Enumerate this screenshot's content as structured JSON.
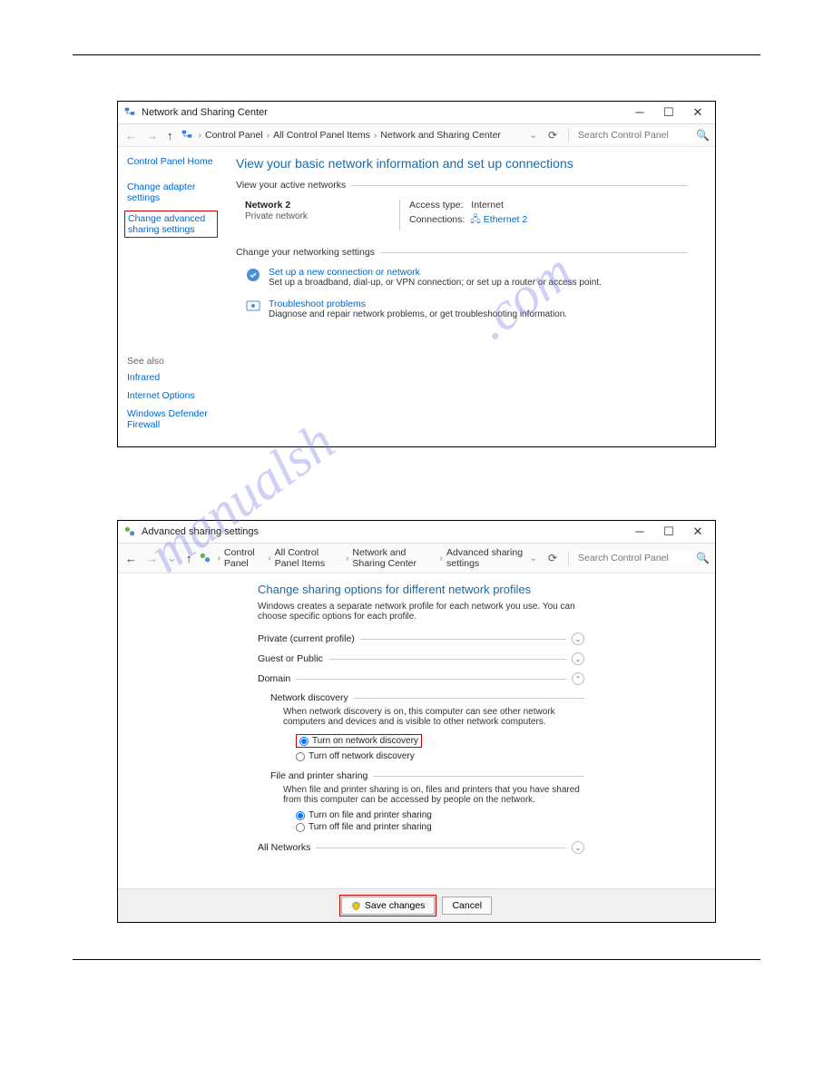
{
  "watermark": "manualshive.com",
  "win1": {
    "title": "Network and Sharing Center",
    "breadcrumb": [
      "Control Panel",
      "All Control Panel Items",
      "Network and Sharing Center"
    ],
    "search_placeholder": "Search Control Panel",
    "sidebar": {
      "home": "Control Panel Home",
      "adapter": "Change adapter settings",
      "advanced": "Change advanced sharing settings"
    },
    "seealso": {
      "heading": "See also",
      "items": [
        "Infrared",
        "Internet Options",
        "Windows Defender Firewall"
      ]
    },
    "main_title": "View your basic network information and set up connections",
    "active_label": "View your active networks",
    "network": {
      "name": "Network 2",
      "type": "Private network",
      "access_label": "Access type:",
      "access_value": "Internet",
      "conn_label": "Connections:",
      "conn_value": "Ethernet 2"
    },
    "change_label": "Change your networking settings",
    "setup": {
      "title": "Set up a new connection or network",
      "desc": "Set up a broadband, dial-up, or VPN connection; or set up a router or access point."
    },
    "trouble": {
      "title": "Troubleshoot problems",
      "desc": "Diagnose and repair network problems, or get troubleshooting information."
    }
  },
  "win2": {
    "title": "Advanced sharing settings",
    "breadcrumb": [
      "Control Panel",
      "All Control Panel Items",
      "Network and Sharing Center",
      "Advanced sharing settings"
    ],
    "search_placeholder": "Search Control Panel",
    "main_title": "Change sharing options for different network profiles",
    "desc": "Windows creates a separate network profile for each network you use. You can choose specific options for each profile.",
    "profiles": {
      "private": "Private (current profile)",
      "guest": "Guest or Public",
      "domain": "Domain",
      "all": "All Networks"
    },
    "discovery": {
      "title": "Network discovery",
      "desc": "When network discovery is on, this computer can see other network computers and devices and is visible to other network computers.",
      "on": "Turn on network discovery",
      "off": "Turn off network discovery"
    },
    "fileshare": {
      "title": "File and printer sharing",
      "desc": "When file and printer sharing is on, files and printers that you have shared from this computer can be accessed by people on the network.",
      "on": "Turn on file and printer sharing",
      "off": "Turn off file and printer sharing"
    },
    "save": "Save changes",
    "cancel": "Cancel"
  }
}
